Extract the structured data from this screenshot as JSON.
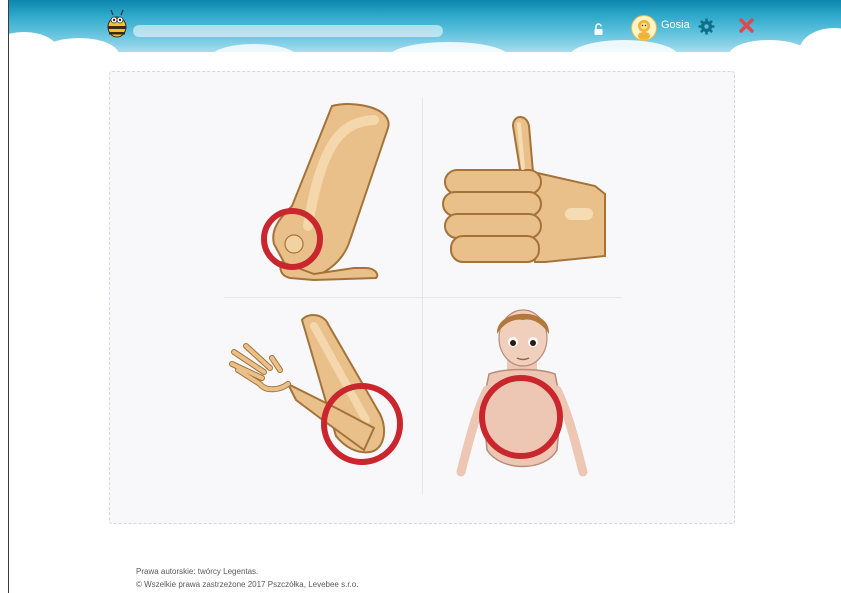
{
  "header": {
    "user_name": "Gosia",
    "icons": [
      "bee-logo-icon",
      "lock-icon",
      "avatar-icon",
      "gear-icon",
      "close-icon"
    ],
    "colors": {
      "sky": "#2aa6c8",
      "gear": "#0e6f8a",
      "close": "#e5444a"
    }
  },
  "board": {
    "cards": [
      {
        "name": "card-leg-ankle",
        "image": "leg-foot-ankle-circled"
      },
      {
        "name": "card-thumbs-up",
        "image": "thumbs-up-hand"
      },
      {
        "name": "card-arm-elbow",
        "image": "arm-elbow-circled"
      },
      {
        "name": "card-boy-chest",
        "image": "boy-chest-circled"
      }
    ],
    "highlight_color": "#c9272d"
  },
  "footer": {
    "copyright_line1": "Prawa autorskie: twórcy Legentas.",
    "copyright_line2": "© Wszelkie prawa zastrzeżone 2017 Pszczółka, Levebee s.r.o."
  }
}
